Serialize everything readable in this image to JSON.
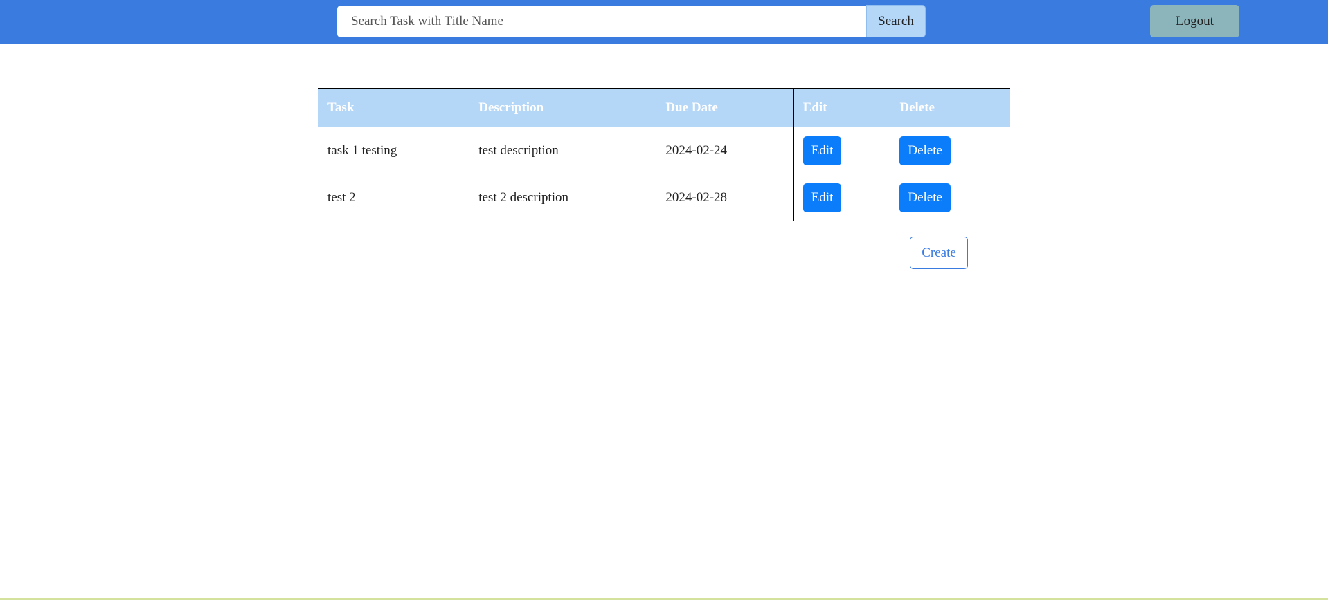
{
  "header": {
    "search": {
      "placeholder": "Search Task with Title Name",
      "value": ""
    },
    "search_label": "Search",
    "logout_label": "Logout"
  },
  "table": {
    "headers": [
      "Task",
      "Description",
      "Due Date",
      "Edit",
      "Delete"
    ],
    "rows": [
      {
        "task": "task 1 testing",
        "description": "test description",
        "due_date": "2024-02-24",
        "edit_label": "Edit",
        "delete_label": "Delete"
      },
      {
        "task": "test 2",
        "description": "test 2 description",
        "due_date": "2024-02-28",
        "edit_label": "Edit",
        "delete_label": "Delete"
      }
    ]
  },
  "create_label": "Create",
  "colors": {
    "header_bar": "#3a7be0",
    "table_header": "#b4d6f7",
    "action_button": "#0b7dfa",
    "logout_button": "#8cb5bb"
  }
}
